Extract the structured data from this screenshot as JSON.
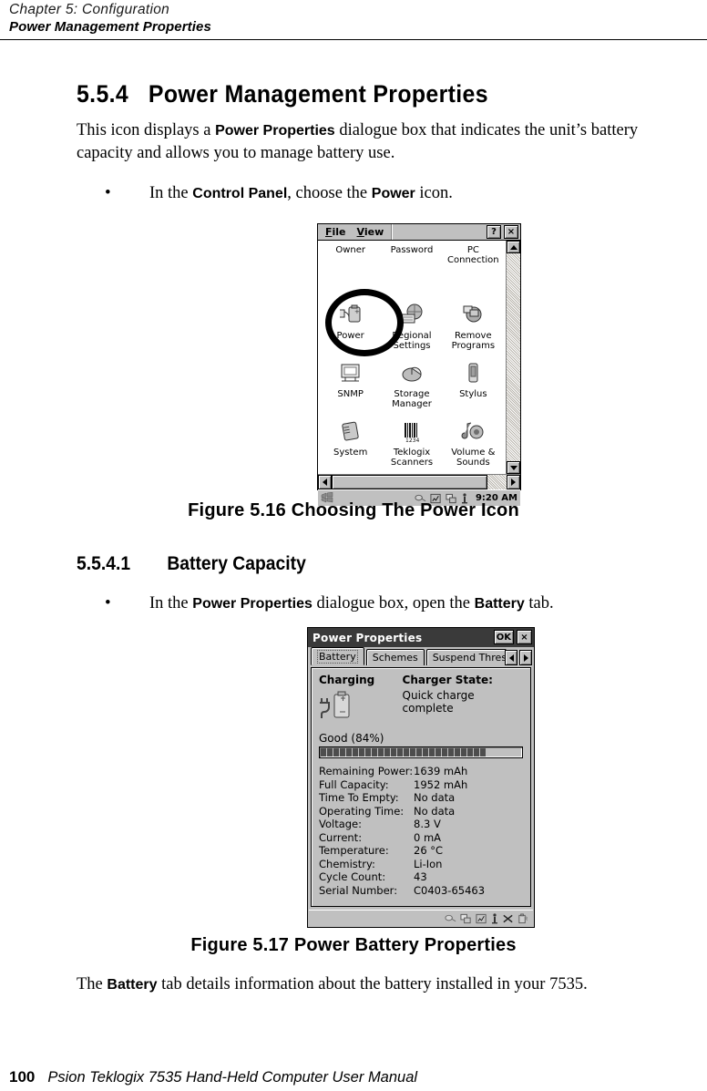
{
  "running_head": {
    "chapter": "Chapter  5:  Configuration",
    "section": "Power Management Properties"
  },
  "section": {
    "number": "5.5.4",
    "title": "Power Management Properties",
    "intro_before": "This icon displays a ",
    "intro_ui": "Power Properties",
    "intro_after": " dialogue box that indicates the unit’s battery capacity and allows you to manage battery use.",
    "bullet1_before": "In the ",
    "bullet1_ui": "Control Panel",
    "bullet1_mid": ", choose the ",
    "bullet1_ui2": "Power",
    "bullet1_after": " icon.",
    "bullet_dot": "•"
  },
  "subsection": {
    "number": "5.5.4.1",
    "title": "Battery Capacity",
    "bullet_before": "In the ",
    "bullet_ui": "Power Properties",
    "bullet_mid": " dialogue box, open the ",
    "bullet_ui2": "Battery",
    "bullet_after": " tab."
  },
  "closing": {
    "before": "The ",
    "ui": "Battery",
    "after": " tab details information about the battery installed in your 7535."
  },
  "figures": {
    "fig1_caption": "Figure  5.16  Choosing  The  Power  Icon",
    "fig2_caption": "Figure  5.17  Power  Battery  Properties"
  },
  "control_panel": {
    "menu": [
      {
        "pre": "F",
        "accel": "F",
        "rest": "ile",
        "label": "File"
      },
      {
        "pre": "V",
        "accel": "V",
        "rest": "iew",
        "label": "View"
      }
    ],
    "menu_file": "File",
    "menu_view": "View",
    "help_button": "?",
    "close_button": "×",
    "icons": [
      {
        "label": "Owner",
        "icon": "owner-icon"
      },
      {
        "label": "Password",
        "icon": "password-icon"
      },
      {
        "label": "PC Connection",
        "icon": "pc-connection-icon"
      },
      {
        "label": "Power",
        "icon": "power-icon"
      },
      {
        "label": "Regional Settings",
        "icon": "regional-settings-icon"
      },
      {
        "label": "Remove Programs",
        "icon": "remove-programs-icon"
      },
      {
        "label": "SNMP",
        "icon": "snmp-icon"
      },
      {
        "label": "Storage Manager",
        "icon": "storage-manager-icon"
      },
      {
        "label": "Stylus",
        "icon": "stylus-icon"
      },
      {
        "label": "System",
        "icon": "system-icon"
      },
      {
        "label": "Teklogix Scanners",
        "icon": "teklogix-scanners-icon"
      },
      {
        "label": "Volume & Sounds",
        "icon": "volume-sounds-icon"
      }
    ],
    "taskbar_clock": "9:20 AM",
    "highlight_target": "Power"
  },
  "power_properties": {
    "title": "Power Properties",
    "ok_button": "OK",
    "close_button": "×",
    "tabs": [
      {
        "label": "Battery",
        "active": true
      },
      {
        "label": "Schemes",
        "active": false
      },
      {
        "label": "Suspend Thres",
        "active": false
      }
    ],
    "charging_header": "Charging",
    "charger_state_label": "Charger State:",
    "charger_state_value": "Quick charge complete",
    "status_text": "Good  (84%)",
    "battery_percent": 84,
    "bar_segments_total": 31,
    "bar_segments_filled": 26,
    "details": [
      {
        "label": "Remaining Power:",
        "value": "1639 mAh"
      },
      {
        "label": "Full Capacity:",
        "value": "1952 mAh"
      },
      {
        "label": "Time To Empty:",
        "value": "No data"
      },
      {
        "label": "Operating Time:",
        "value": "No data"
      },
      {
        "label": "Voltage:",
        "value": "8.3 V"
      },
      {
        "label": "Current:",
        "value": "0 mA"
      },
      {
        "label": "Temperature:",
        "value": "26 °C"
      },
      {
        "label": "Chemistry:",
        "value": "Li-Ion"
      },
      {
        "label": "Cycle Count:",
        "value": "43"
      },
      {
        "label": "Serial Number:",
        "value": "C0403-65463"
      }
    ]
  },
  "footer": {
    "page_number": "100",
    "manual_title": "Psion Teklogix 7535 Hand-Held Computer User Manual"
  }
}
